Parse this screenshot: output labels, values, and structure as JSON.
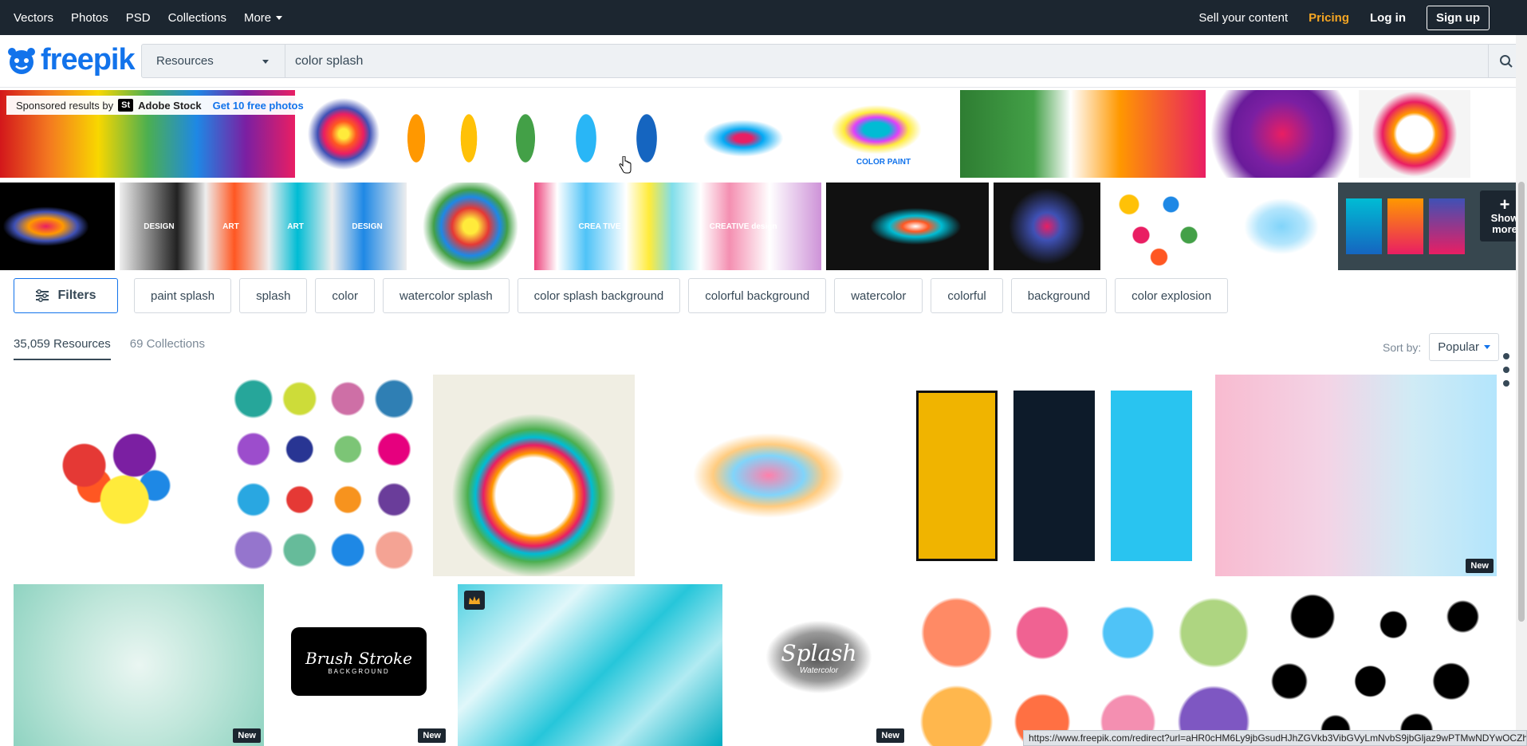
{
  "topbar": {
    "nav": [
      "Vectors",
      "Photos",
      "PSD",
      "Collections",
      "More"
    ],
    "sell": "Sell your content",
    "pricing": "Pricing",
    "login": "Log in",
    "signup": "Sign up"
  },
  "logo": {
    "text": "freepik"
  },
  "search": {
    "category": "Resources",
    "query": "color splash"
  },
  "sponsored": {
    "label": "Sponsored results by",
    "st": "St",
    "brand": "Adobe Stock",
    "offer": "Get 10 free photos",
    "show_more_plus": "+",
    "show_more": "Show more",
    "art_texts": [
      "COLOR PAINT",
      "CREA TIVE",
      "CREATIVE design",
      "DESIGN",
      "ART"
    ]
  },
  "filters": {
    "label": "Filters"
  },
  "tags": [
    "paint splash",
    "splash",
    "color",
    "watercolor splash",
    "color splash background",
    "colorful background",
    "watercolor",
    "colorful",
    "background",
    "color explosion"
  ],
  "counts": {
    "resources": "35,059 Resources",
    "collections": "69 Collections"
  },
  "sort": {
    "label": "Sort by:",
    "value": "Popular"
  },
  "results": {
    "new_badge": "New",
    "brush_title": "Brush Stroke",
    "brush_sub": "BACKGROUND",
    "splash_title": "Splash",
    "splash_sub": "Watercolor"
  },
  "status_url": "https://www.freepik.com/redirect?url=aHR0cHM6Ly9jbGsudHJhZGVkb3VibGVyLmNvbS9jbGljaz9wPTMwNDYwOCZh...",
  "colors": {
    "brand": "#1273eb",
    "topbar": "#1c2630",
    "pricing": "#f5a623"
  }
}
